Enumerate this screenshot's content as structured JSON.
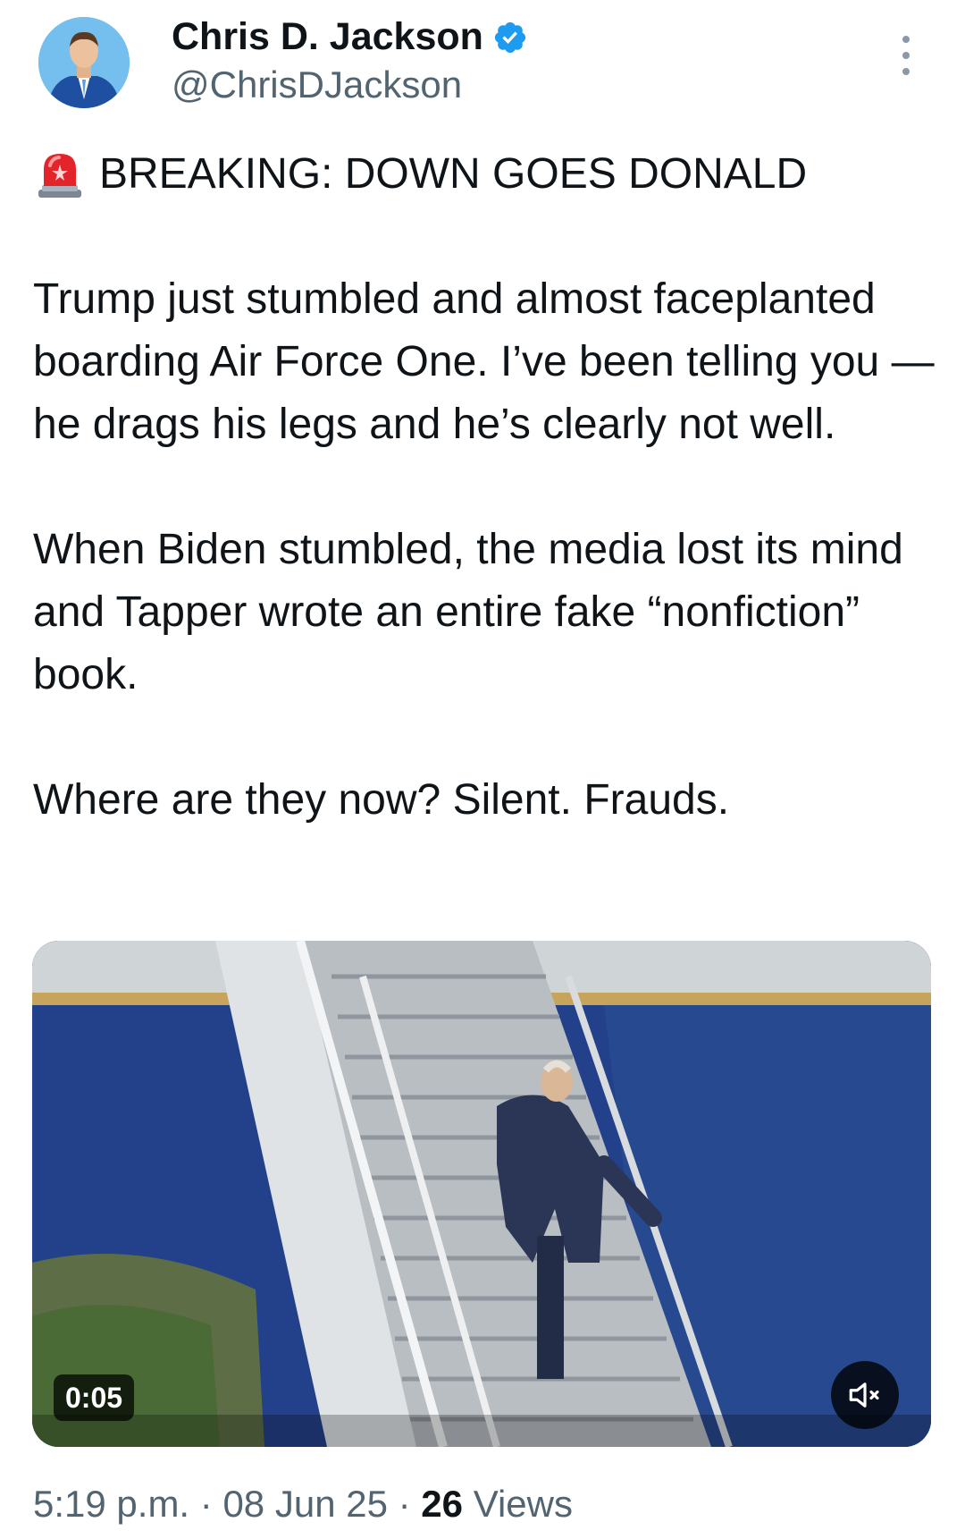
{
  "author": {
    "display_name": "Chris D. Jackson",
    "handle": "@ChrisDJackson",
    "verified": true
  },
  "tweet": {
    "headline": "BREAKING: DOWN GOES DONALD",
    "headline_icon": "police-car-light-icon",
    "paragraphs": [
      "Trump just stumbled and almost faceplanted boarding Air Force One. I’ve been telling you — he drags his legs and he’s clearly not well.",
      "When Biden stumbled, the media lost its mind and Tapper wrote an entire fake “nonfiction” book.",
      "Where are they now? Silent. Frauds."
    ]
  },
  "media": {
    "type": "video",
    "duration": "0:05",
    "mute_icon": "speaker-muted-icon"
  },
  "meta": {
    "time": "5:19 p.m.",
    "date": "08 Jun 25",
    "views_count": "26",
    "views_label": "Views",
    "separator": "·"
  },
  "colors": {
    "text_primary": "#0f1419",
    "text_secondary": "#536471",
    "verified_blue": "#1d9bf0"
  }
}
